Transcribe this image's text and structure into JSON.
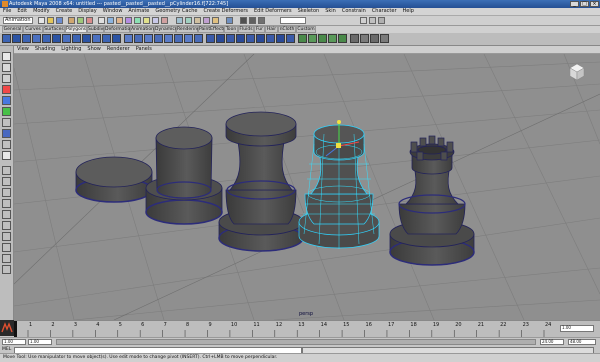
{
  "window": {
    "title": "Autodesk Maya 2008 x64: untitled   ---   pasted__pasted__pasted__pCylinder16.f[722:745]"
  },
  "menu": [
    "File",
    "Edit",
    "Modify",
    "Create",
    "Display",
    "Window",
    "Animate",
    "Geometry Cache",
    "Create Deformers",
    "Edit Deformers",
    "Skeleton",
    "Skin",
    "Constrain",
    "Character",
    "Help"
  ],
  "status_line": {
    "mode": "Animation"
  },
  "shelf_tabs": [
    "General",
    "Curves",
    "Surfaces",
    "Polygons",
    "Subdivs",
    "Deformation",
    "Animation",
    "Dynamics",
    "Rendering",
    "PaintEffects",
    "Toon",
    "Fluids",
    "Fur",
    "Hair",
    "nCloth",
    "Custom"
  ],
  "active_shelf_tab": "Polygons",
  "panel_menu": [
    "View",
    "Shading",
    "Lighting",
    "Show",
    "Renderer",
    "Panels"
  ],
  "viewport": {
    "camera_label": "persp"
  },
  "time_slider": {
    "ticks": [
      "1",
      "2",
      "3",
      "4",
      "5",
      "6",
      "7",
      "8",
      "9",
      "10",
      "11",
      "12",
      "13",
      "14",
      "15",
      "16",
      "17",
      "18",
      "19",
      "20",
      "21",
      "22",
      "23",
      "24"
    ],
    "current_frame": "1.00"
  },
  "range_slider": {
    "start": "1.00",
    "playback_start": "1.00",
    "playback_end": "24.00",
    "end": "48.00"
  },
  "command_line": {
    "label": "MEL"
  },
  "help_line": {
    "text": "Move Tool: Use manipulator to move object(s). Use edit mode to change pivot (INSERT). Ctrl+LMB to move perpendicular."
  },
  "colors": {
    "title_bar": "#2d5ea8",
    "viewport_bg": "#8f8f8f",
    "selection": "#2fd4ff",
    "mesh": "#4a4a4a",
    "mesh_edge": "#2a2a6a"
  }
}
